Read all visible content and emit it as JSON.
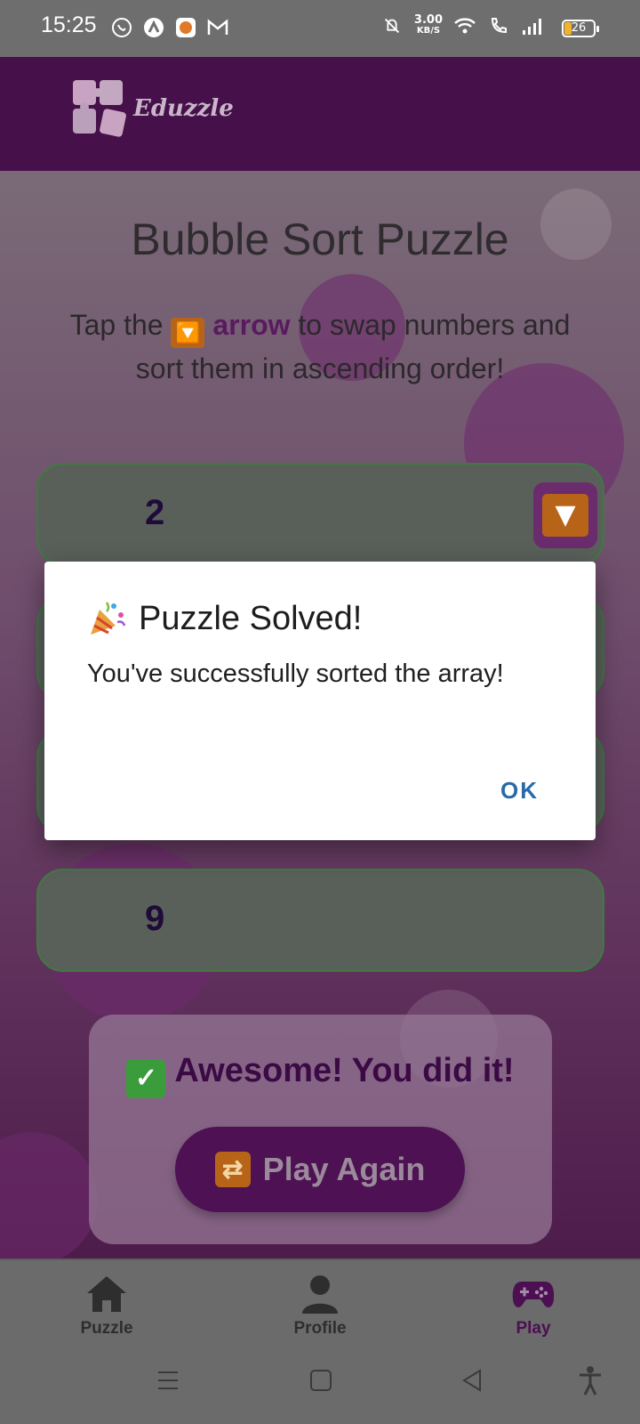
{
  "status_bar": {
    "time": "15:25",
    "net_speed_value": "3.00",
    "net_speed_unit": "KB/S",
    "battery_level": "26",
    "icons_left": [
      "whatsapp-icon",
      "arrow-app-icon",
      "shop-app-icon",
      "gmail-icon"
    ],
    "icons_right": [
      "silent-icon",
      "wifi-icon",
      "wifi-calling-icon",
      "signal-icon",
      "battery-icon"
    ]
  },
  "header": {
    "logo_text": "Eduzzle"
  },
  "page": {
    "title": "Bubble Sort Puzzle",
    "instruction_prefix": "Tap the",
    "instruction_arrow_emoji": "🔽",
    "instruction_arrow_word": "arrow",
    "instruction_suffix": "to swap numbers and sort them in ascending order!"
  },
  "rows": [
    {
      "value": "2",
      "has_swap": true
    },
    {
      "value": "9",
      "has_swap": false
    }
  ],
  "result": {
    "check_emoji": "✅",
    "message": "Awesome! You did it!",
    "play_again_emoji": "🔁",
    "play_again_label": "Play Again"
  },
  "dialog": {
    "title_emoji": "🎉",
    "title": "Puzzle Solved!",
    "message": "You've successfully sorted the array!",
    "ok_label": "OK"
  },
  "bottom_nav": {
    "items": [
      {
        "label": "Puzzle",
        "icon": "home-icon",
        "active": false
      },
      {
        "label": "Profile",
        "icon": "person-icon",
        "active": false
      },
      {
        "label": "Play",
        "icon": "gamepad-icon",
        "active": true
      }
    ]
  },
  "colors": {
    "header_bg": "#46104a",
    "accent_purple": "#4b0f52",
    "row_bg": "#59605a",
    "row_border": "#3e7a40",
    "ok_blue": "#2a6aa8"
  }
}
